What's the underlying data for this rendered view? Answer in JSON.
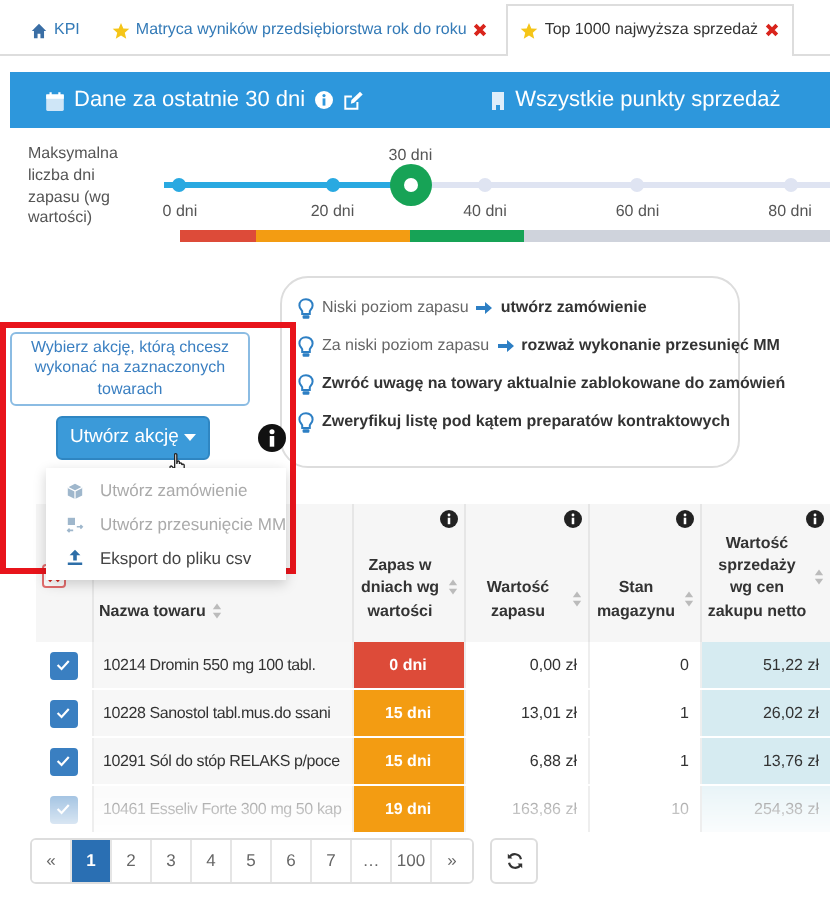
{
  "tabs": [
    {
      "label": "KPI",
      "selected": false,
      "closable": false
    },
    {
      "label": "Matryca wyników przedsiębiorstwa rok do roku",
      "selected": false,
      "closable": true
    },
    {
      "label": "Top 1000 najwyższa sprzedaż",
      "selected": true,
      "closable": true
    }
  ],
  "filter_bar": {
    "period": "Dane za ostatnie 30 dni",
    "locations": "Wszystkie punkty sprzedaż"
  },
  "slider": {
    "label": "Maksymalna liczba dni zapasu (wg wartości)",
    "value_label": "30 dni",
    "level": 0.37,
    "ticks": [
      "0 dni",
      "20 dni",
      "40 dni",
      "60 dni",
      "80 dni"
    ]
  },
  "actions": {
    "hint": "Wybierz akcję, którą chcesz wykonać na zaznaczonych towarach",
    "button": "Utwórz akcję",
    "menu": [
      {
        "label": "Utwórz zamówienie",
        "disabled": true
      },
      {
        "label": "Utwórz przesunięcie MM",
        "disabled": true
      },
      {
        "label": "Eksport do pliku csv",
        "disabled": false
      }
    ]
  },
  "tips": [
    {
      "kind": "action",
      "text": "Niski poziom zapasu",
      "action": "utwórz zamówienie"
    },
    {
      "kind": "action",
      "text": "Za niski poziom zapasu",
      "action": "rozważ wykonanie przesunięć MM"
    },
    {
      "kind": "note",
      "text": "Zwróć uwagę na towary aktualnie zablokowane do zamówień"
    },
    {
      "kind": "note",
      "text": "Zweryfikuj listę pod kątem preparatów kontraktowych"
    }
  ],
  "table": {
    "columns": [
      {
        "label": "Nazwa towaru",
        "info": false
      },
      {
        "label": "Zapas w dniach wg wartości",
        "info": true
      },
      {
        "label": "Wartość zapasu",
        "info": true
      },
      {
        "label": "Stan magazynu",
        "info": true
      },
      {
        "label": "Wartość sprzedaży wg cen zakupu netto",
        "info": true
      }
    ],
    "rows": [
      {
        "checked": true,
        "name": "10214 Dromin 550 mg 100 tabl.",
        "days": "0 dni",
        "color": "#dd4b39",
        "value": "0,00 zł",
        "stock": "0",
        "sales": "51,22 zł"
      },
      {
        "checked": true,
        "name": "10228 Sanostol tabl.mus.do ssani",
        "days": "15 dni",
        "color": "#f39c12",
        "value": "13,01 zł",
        "stock": "1",
        "sales": "26,02 zł"
      },
      {
        "checked": true,
        "name": "10291 Sól do stóp RELAKS p/poce",
        "days": "15 dni",
        "color": "#f39c12",
        "value": "6,88 zł",
        "stock": "1",
        "sales": "13,76 zł"
      },
      {
        "checked": true,
        "name": "10461 Esseliv Forte 300 mg 50 kap",
        "days": "19 dni",
        "color": "#f39c12",
        "value": "163,86 zł",
        "stock": "10",
        "sales": "254,38 zł"
      }
    ]
  },
  "pagination": [
    {
      "label": "«",
      "selected": false
    },
    {
      "label": "1",
      "selected": true
    },
    {
      "label": "2",
      "selected": false
    },
    {
      "label": "3",
      "selected": false
    },
    {
      "label": "4",
      "selected": false
    },
    {
      "label": "5",
      "selected": false
    },
    {
      "label": "6",
      "selected": false
    },
    {
      "label": "7",
      "selected": false
    },
    {
      "label": "…",
      "selected": false
    },
    {
      "label": "100",
      "selected": false
    },
    {
      "label": "»",
      "selected": false
    }
  ]
}
